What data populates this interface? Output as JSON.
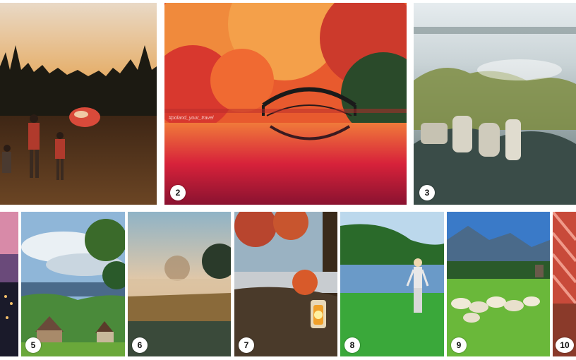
{
  "collage": {
    "top": [
      {
        "label": ""
      },
      {
        "label": "2",
        "watermark": "#poland_your_travel"
      },
      {
        "label": "3"
      }
    ],
    "bottom": [
      {
        "label": ""
      },
      {
        "label": "5"
      },
      {
        "label": "6"
      },
      {
        "label": "7"
      },
      {
        "label": "8"
      },
      {
        "label": "9"
      },
      {
        "label": "10"
      }
    ]
  }
}
